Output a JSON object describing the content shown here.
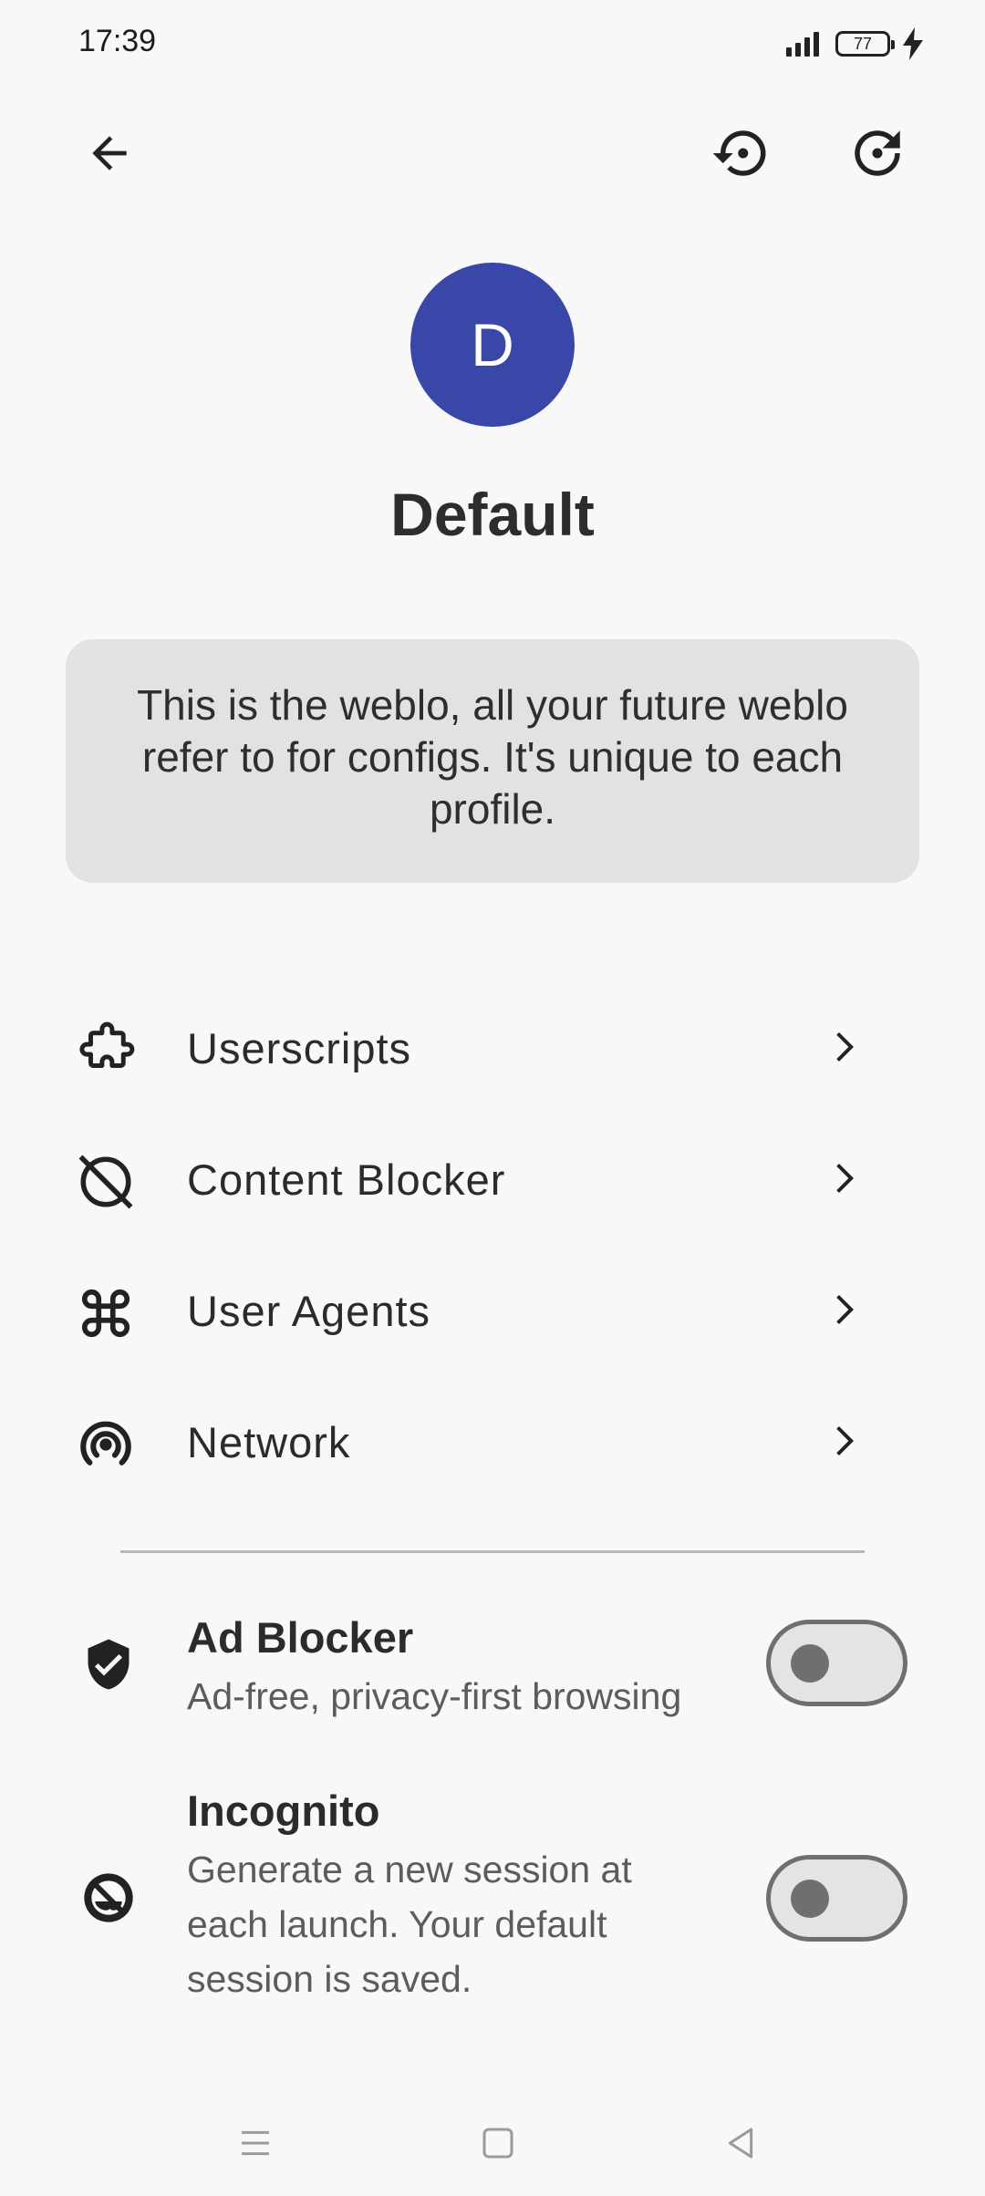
{
  "status_bar": {
    "time": "17:39",
    "battery_level": "77"
  },
  "toolbar": {
    "back_icon": "arrow-left-icon",
    "restore_icon": "history-restore-icon",
    "refresh_icon": "refresh-icon"
  },
  "profile": {
    "initial": "D",
    "name": "Default",
    "avatar_color": "#3847a8"
  },
  "info_card": {
    "text": "This is the weblo, all your future weblo refer to for configs. It's unique to each profile."
  },
  "menu": {
    "items": [
      {
        "label": "Userscripts",
        "icon": "puzzle-icon"
      },
      {
        "label": "Content Blocker",
        "icon": "block-icon"
      },
      {
        "label": "User Agents",
        "icon": "command-icon"
      },
      {
        "label": "Network",
        "icon": "broadcast-icon"
      }
    ]
  },
  "toggles": {
    "ad_blocker": {
      "title": "Ad Blocker",
      "subtitle": "Ad-free, privacy-first browsing",
      "enabled": false,
      "icon": "shield-check-icon"
    },
    "incognito": {
      "title": "Incognito",
      "subtitle": "Generate a new session at each launch. Your default session is saved.",
      "enabled": false,
      "icon": "incognito-icon"
    }
  },
  "nav_bar": {
    "icons": [
      "menu-icon",
      "home-icon",
      "back-triangle-icon"
    ]
  }
}
